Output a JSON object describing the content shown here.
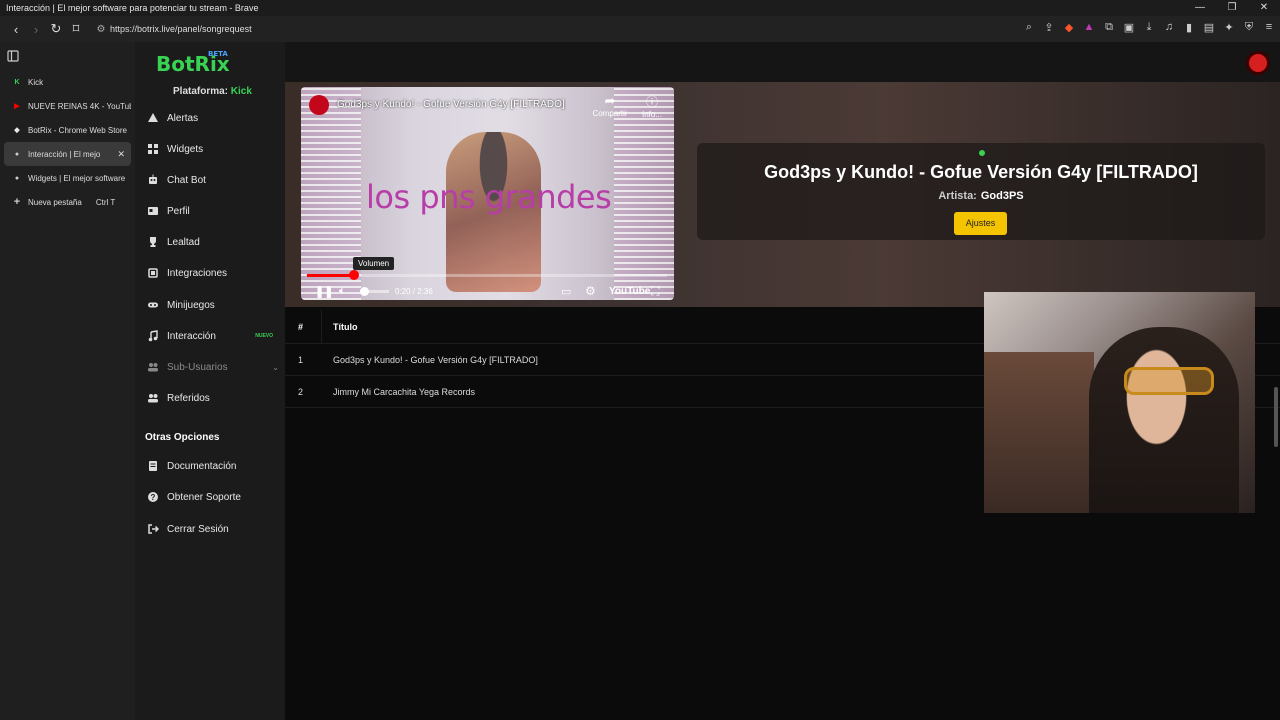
{
  "window": {
    "title": "Interacción | El mejor software para potenciar tu stream - Brave"
  },
  "browser": {
    "url": "https://botrix.live/panel/songrequest"
  },
  "tabs": [
    {
      "label": "Kick",
      "favicon_color": "#39d353",
      "favicon_glyph": "K"
    },
    {
      "label": "NUEVE REINAS 4K - YouTub",
      "favicon_color": "#ff0000",
      "favicon_glyph": "▶"
    },
    {
      "label": "BotRix - Chrome Web Store",
      "favicon_color": "#e8e8e8",
      "favicon_glyph": "◆"
    },
    {
      "label": "Interacción | El mejo",
      "favicon_color": "#cccccc",
      "favicon_glyph": "●",
      "active": true
    },
    {
      "label": "Widgets | El mejor software",
      "favicon_color": "#cccccc",
      "favicon_glyph": "●"
    }
  ],
  "new_tab": {
    "label": "Nueva pestaña",
    "shortcut": "Ctrl   T"
  },
  "sidebar": {
    "logo": "BotRix",
    "logo_badge": "BETA",
    "platform_label": "Plataforma:",
    "platform_value": "Kick",
    "items": [
      {
        "label": "Alertas",
        "icon": "warning-icon"
      },
      {
        "label": "Widgets",
        "icon": "grid-icon"
      },
      {
        "label": "Chat Bot",
        "icon": "robot-icon"
      },
      {
        "label": "Perfil",
        "icon": "id-card-icon"
      },
      {
        "label": "Lealtad",
        "icon": "trophy-icon"
      },
      {
        "label": "Integraciones",
        "icon": "plug-icon"
      },
      {
        "label": "Minijuegos",
        "icon": "gamepad-icon"
      },
      {
        "label": "Interacción",
        "icon": "music-icon",
        "badge": "NUEVO"
      },
      {
        "label": "Sub-Usuarios",
        "icon": "users-icon"
      },
      {
        "label": "Referidos",
        "icon": "user-group-icon"
      }
    ],
    "other_heading": "Otras Opciones",
    "other_items": [
      {
        "label": "Documentación",
        "icon": "doc-icon"
      },
      {
        "label": "Obtener Soporte",
        "icon": "help-icon"
      },
      {
        "label": "Cerrar Sesión",
        "icon": "logout-icon"
      }
    ]
  },
  "player": {
    "video_title": "God3ps y Kundo! - Gofue Versión G4y [FILTRADO]",
    "share_label": "Compartir",
    "info_label": "Info...",
    "caption": "los pns grandes",
    "tooltip": "Volumen",
    "time": "0:20 / 2:36",
    "progress": 0.13,
    "brand": "YouTube"
  },
  "now_playing": {
    "title": "God3ps y Kundo! - Gofue Versión G4y [FILTRADO]",
    "artist_label": "Artista:",
    "artist": "God3PS",
    "settings_button": "Ajustes"
  },
  "queue": {
    "headers": [
      "#",
      "Título"
    ],
    "rows": [
      {
        "n": "1",
        "title": "God3ps y Kundo! - Gofue Versión G4y [FILTRADO]"
      },
      {
        "n": "2",
        "title": "Jimmy Mi Carcachita Yega Records"
      }
    ]
  },
  "colors": {
    "accent": "#39d353",
    "button": "#f5c400",
    "brand_blue": "#4aa3ff"
  }
}
